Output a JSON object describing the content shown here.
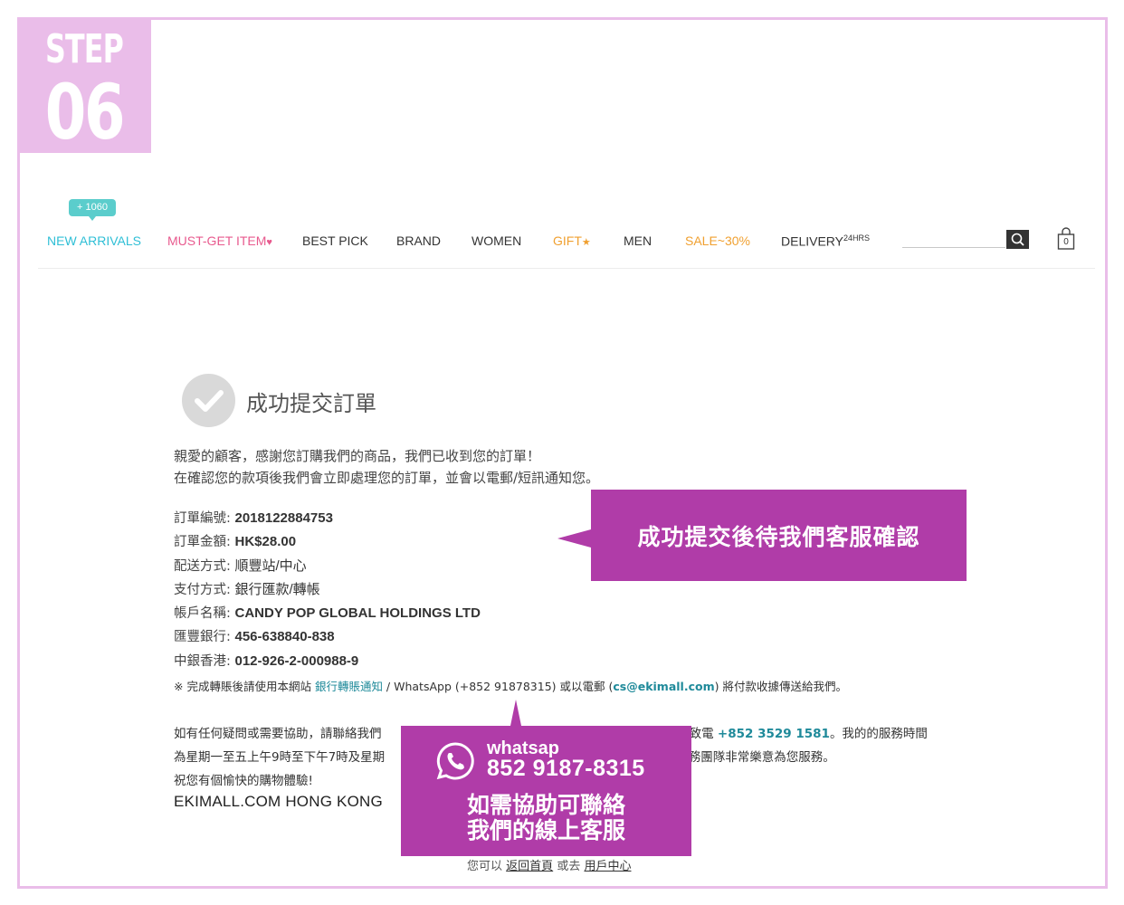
{
  "step": {
    "word": "STEP",
    "number": "06"
  },
  "nav": {
    "badge": "+ 1060",
    "items": [
      {
        "label": "NEW ARRIVALS",
        "color": "#2fbfd6"
      },
      {
        "label": "MUST-GET ITEM",
        "suffix": "♥",
        "color": "#e85a8e"
      },
      {
        "label": "BEST PICK"
      },
      {
        "label": "BRAND"
      },
      {
        "label": "WOMEN"
      },
      {
        "label": "GIFT",
        "suffix": "★",
        "color": "#f0a030"
      },
      {
        "label": "MEN"
      },
      {
        "label": "SALE~30%",
        "color": "#f0a030"
      },
      {
        "label": "DELIVERY",
        "sup": "24HRS"
      }
    ],
    "search_placeholder": "",
    "cart_count": "0"
  },
  "order": {
    "title": "成功提交訂單",
    "intro_line1": "親愛的顧客，感謝您訂購我們的商品，我們已收到您的訂單！",
    "intro_line2": "在確認您的款項後我們會立即處理您的訂單，並會以電郵/短訊通知您。",
    "details": [
      {
        "label": "訂單編號:",
        "value": "2018122884753"
      },
      {
        "label": "訂單金額:",
        "value": "HK$28.00"
      },
      {
        "label": "配送方式:",
        "value": "順豐站/中心"
      },
      {
        "label": "支付方式:",
        "value": "銀行匯款/轉帳"
      },
      {
        "label": "帳戶名稱:",
        "value": "CANDY POP GLOBAL HOLDINGS LTD"
      },
      {
        "label": "匯豐銀行:",
        "value": "456-638840-838"
      },
      {
        "label": "中銀香港:",
        "value": "012-926-2-000988-9"
      }
    ],
    "note": {
      "prefix": "※ 完成轉賬後請使用本網站",
      "link": "銀行轉賬通知",
      "middle": " / WhatsApp (+852 91878315) 或以電郵 (",
      "email": "cs@ekimall.com",
      "suffix": ") 將付款收據傳送給我們。"
    },
    "help": {
      "line1_start": "如有任何疑問或需要協助，請聯絡我們",
      "line1_mid": "或致電",
      "phone": "+852 3529 1581",
      "line1_end": "。我的的服務時間",
      "line2_start": "為星期一至五上午9時至下午7時及星期",
      "line2_end": "戶服務團隊非常樂意為您服務。",
      "line3": "祝您有個愉快的購物體驗!"
    },
    "signature": "EKIMALL.COM HONG KONG"
  },
  "footer": {
    "prefix": "您可以",
    "home_link": "返回首頁",
    "or": "或去",
    "account_link": "用戶中心"
  },
  "callouts": {
    "confirm": "成功提交後待我們客服確認",
    "whatsapp_label": "whatsap",
    "whatsapp_number": "852 9187-8315",
    "help_line1": "如需協助可聯絡",
    "help_line2": "我們的線上客服",
    "color": "#b03ca8"
  }
}
